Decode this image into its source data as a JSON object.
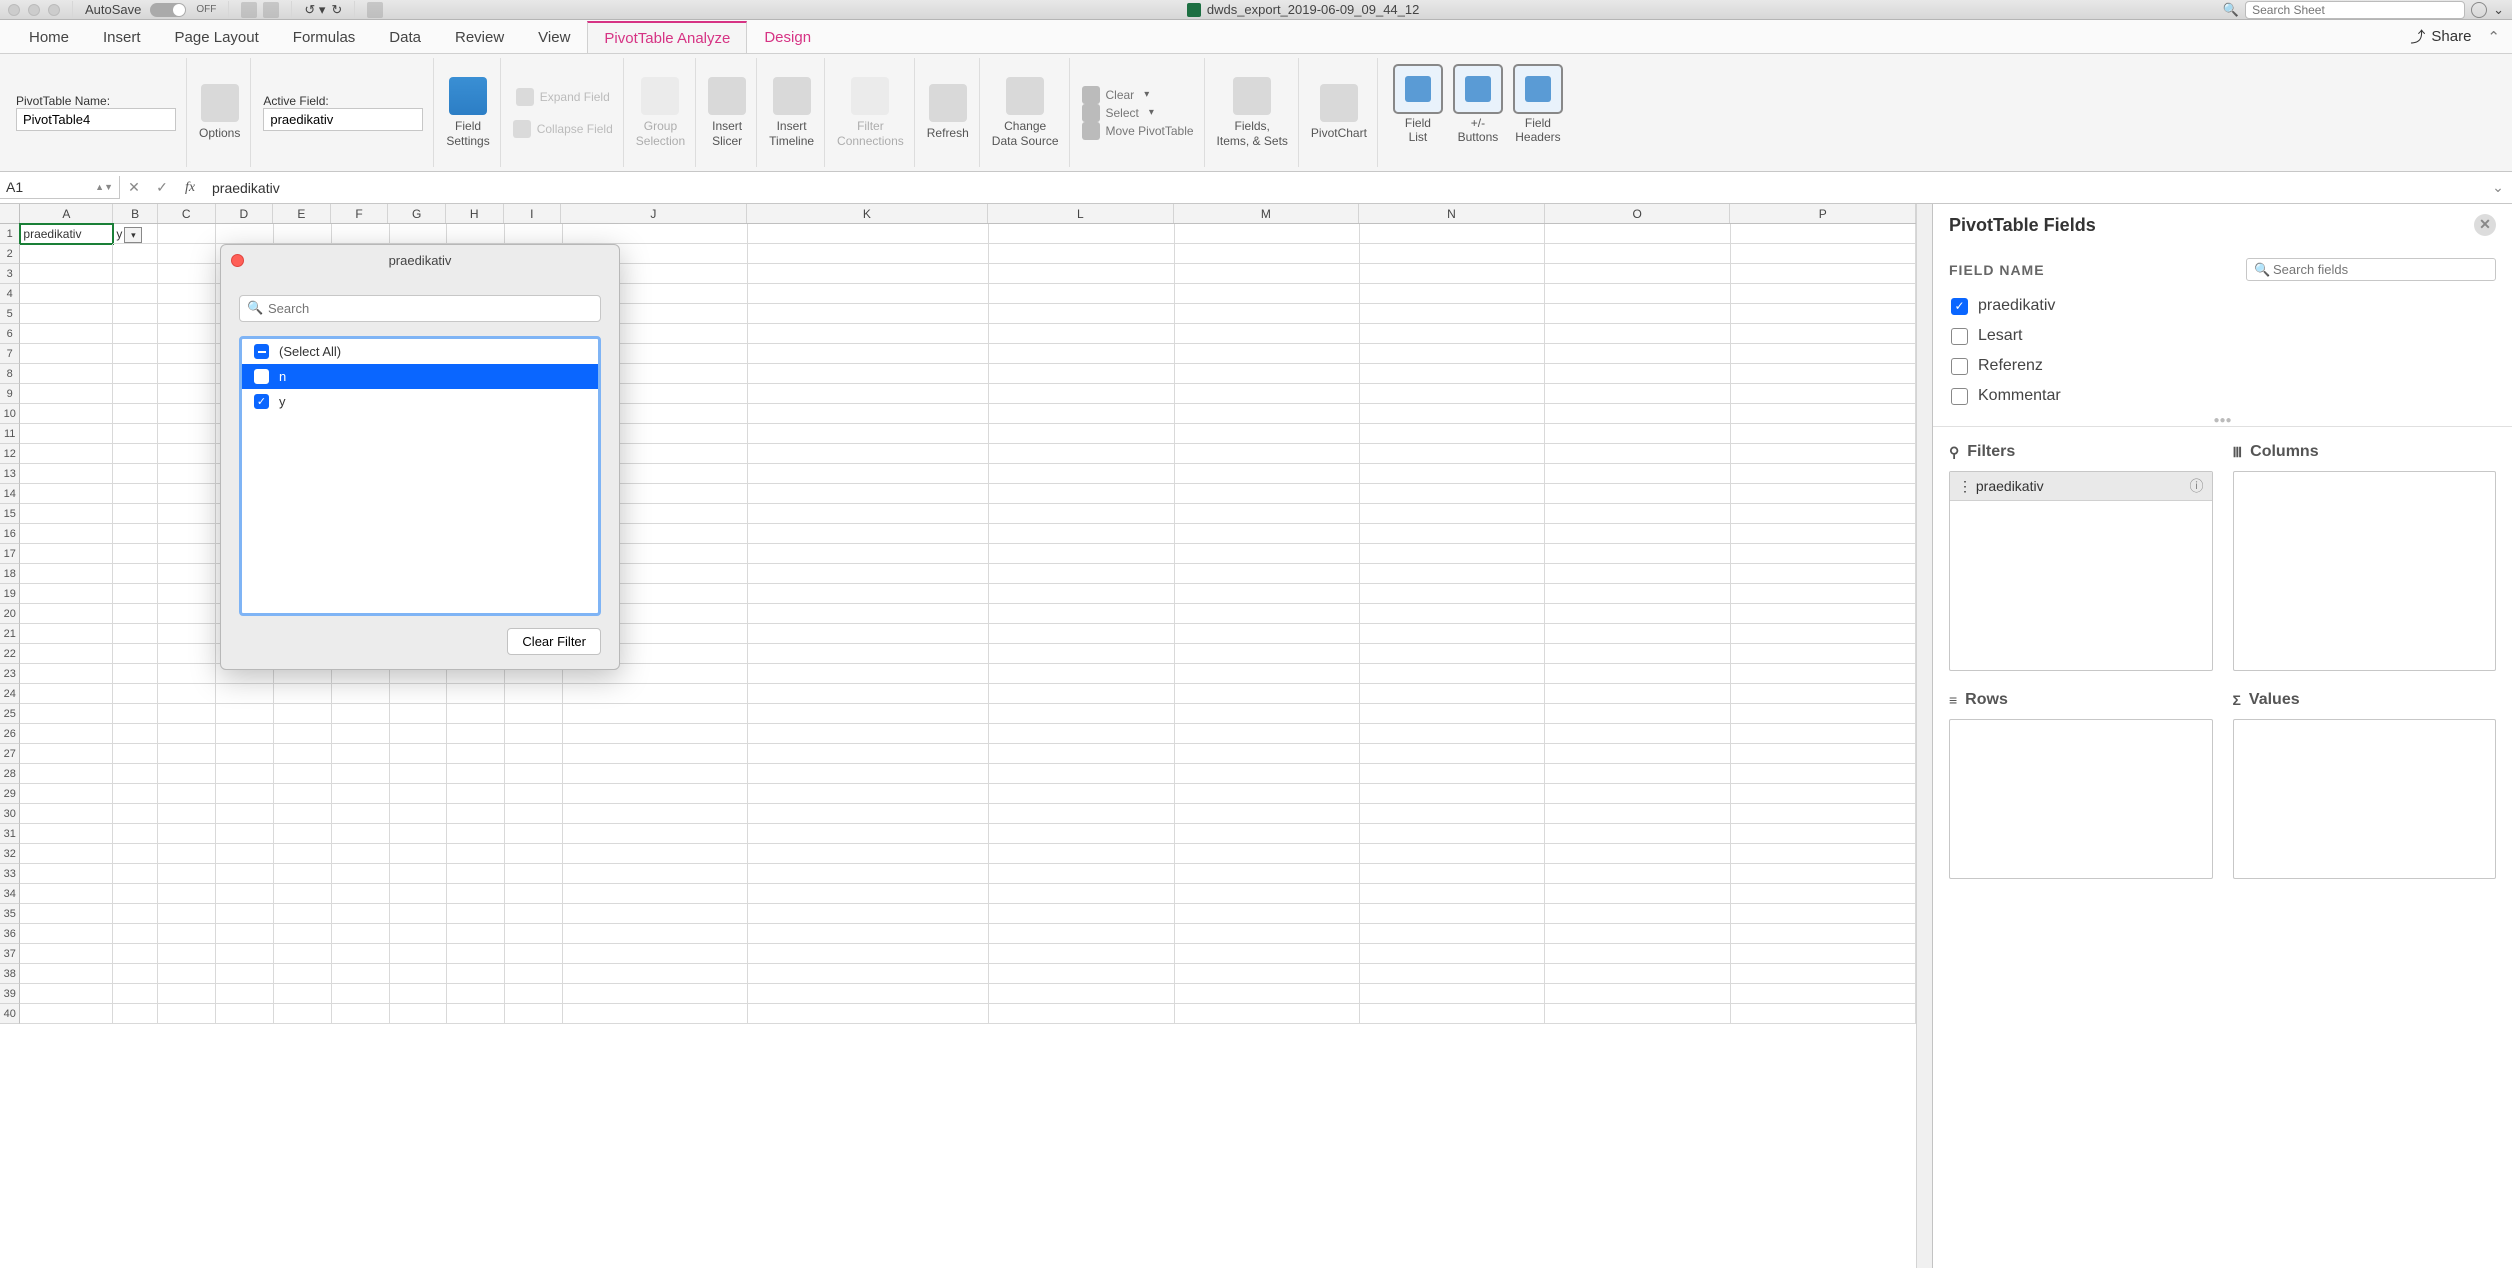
{
  "titlebar": {
    "autosave_label": "AutoSave",
    "autosave_state": "OFF",
    "doc_title": "dwds_export_2019-06-09_09_44_12",
    "search_placeholder": "Search Sheet"
  },
  "tabs": {
    "items": [
      "Home",
      "Insert",
      "Page Layout",
      "Formulas",
      "Data",
      "Review",
      "View",
      "PivotTable Analyze",
      "Design"
    ],
    "active": "PivotTable Analyze",
    "share": "Share"
  },
  "ribbon": {
    "pt_name_label": "PivotTable Name:",
    "pt_name_value": "PivotTable4",
    "options": "Options",
    "active_field_label": "Active Field:",
    "active_field_value": "praedikativ",
    "field_settings": "Field\nSettings",
    "expand": "Expand Field",
    "collapse": "Collapse Field",
    "group_sel": "Group\nSelection",
    "insert_slicer": "Insert\nSlicer",
    "insert_timeline": "Insert\nTimeline",
    "filter_conn": "Filter\nConnections",
    "refresh": "Refresh",
    "change_ds": "Change\nData Source",
    "clear": "Clear",
    "select": "Select",
    "move": "Move PivotTable",
    "fields_items": "Fields,\nItems, & Sets",
    "pivotchart": "PivotChart",
    "field_list": "Field\nList",
    "buttons": "+/-\nButtons",
    "field_headers": "Field\nHeaders"
  },
  "formula_bar": {
    "cell_ref": "A1",
    "value": "praedikativ"
  },
  "grid": {
    "columns": [
      "A",
      "B",
      "C",
      "D",
      "E",
      "F",
      "G",
      "H",
      "I",
      "J",
      "K",
      "L",
      "M",
      "N",
      "O",
      "P"
    ],
    "a1": "praedikativ",
    "b1": "y",
    "row_count": 40
  },
  "filter_popup": {
    "title": "praedikativ",
    "search_placeholder": "Search",
    "select_all": "(Select All)",
    "opt_n": "n",
    "opt_y": "y",
    "clear": "Clear Filter"
  },
  "fields_pane": {
    "title": "PivotTable Fields",
    "field_name_label": "FIELD NAME",
    "search_placeholder": "Search fields",
    "fields": [
      {
        "label": "praedikativ",
        "checked": true
      },
      {
        "label": "Lesart",
        "checked": false
      },
      {
        "label": "Referenz",
        "checked": false
      },
      {
        "label": "Kommentar",
        "checked": false
      }
    ],
    "areas": {
      "filters": "Filters",
      "columns": "Columns",
      "rows": "Rows",
      "values": "Values",
      "filter_pill": "praedikativ"
    }
  }
}
